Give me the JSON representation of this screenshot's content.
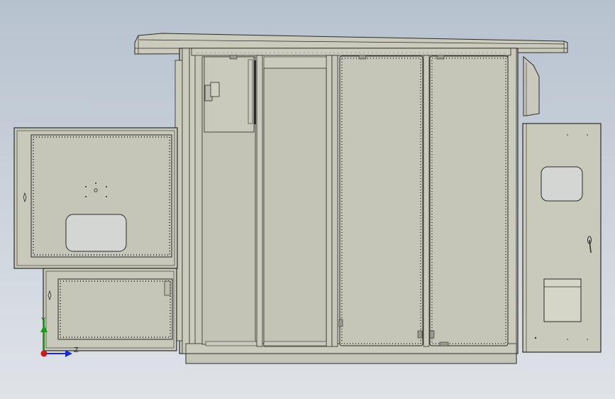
{
  "viewport": {
    "background_top": "#b7c2cf",
    "background_bottom": "#dfe3e8",
    "model": "switchgear-cabinet-front-view",
    "body_color": "#cacabc",
    "edge_color": "#2b2b2b"
  },
  "triad": {
    "y_label": "Y",
    "z_label": "Z",
    "x_color": "#d01818",
    "y_color": "#12a012",
    "z_color": "#1a2ad0"
  }
}
